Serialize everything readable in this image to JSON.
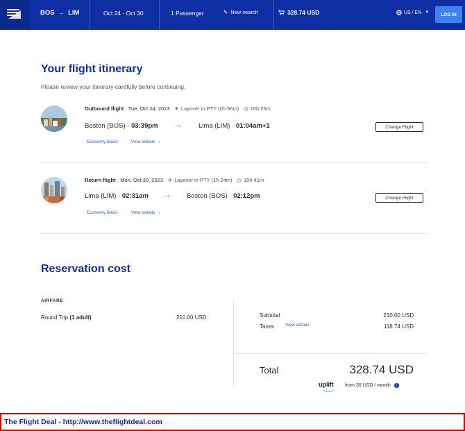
{
  "header": {
    "origin": "BOS",
    "destination": "LIM",
    "dates": "Oct 24 - Oct 30",
    "passengers": "1 Passenger",
    "new_search": "New search",
    "cart_total": "328.74 USD",
    "locale": "US / EN",
    "login": "LOG IN",
    "colors": {
      "bar": "#0d2fa3",
      "login": "#3b82f6"
    }
  },
  "itinerary": {
    "title": "Your flight itinerary",
    "subtitle": "Please review your itinerary carefully before continuing.",
    "flights": [
      {
        "label": "Outbound flight",
        "date": "Tue, Oct 24, 2023",
        "layover": "Layover in PTY (0h 56m)",
        "duration": "10h 25m",
        "from": "Boston (BOS)",
        "from_time": "03:39pm",
        "to": "Lima (LIM)",
        "to_time": "01:04am+1",
        "fare": "Economy Basic",
        "details": "View details",
        "change": "Change Flight"
      },
      {
        "label": "Return flight",
        "date": "Mon, Oct 30, 2023",
        "layover": "Layover in PTY (1h 24m)",
        "duration": "10h 41m",
        "from": "Lima (LIM)",
        "from_time": "02:31am",
        "to": "Boston (BOS)",
        "to_time": "02:12pm",
        "fare": "Economy Basic",
        "details": "View details",
        "change": "Change Flight"
      }
    ]
  },
  "cost": {
    "title": "Reservation cost",
    "airfare_heading": "AIRFARE",
    "round_trip_label": "Round Trip",
    "round_trip_pax": "(1 adult)",
    "round_trip_amount": "210.00 USD",
    "subtotal_label": "Subtotal",
    "subtotal_value": "210.00 USD",
    "taxes_label": "Taxes",
    "taxes_link": "View details",
    "taxes_value": "118.74 USD",
    "total_label": "Total",
    "total_value": "328.74 USD",
    "uplift_brand": "uplift",
    "uplift_text": "from 35 USD  / month"
  },
  "banner": {
    "text": "The Flight Deal - http://www.theflightdeal.com",
    "border_color": "#e00000",
    "text_color": "#1a1ad6"
  }
}
